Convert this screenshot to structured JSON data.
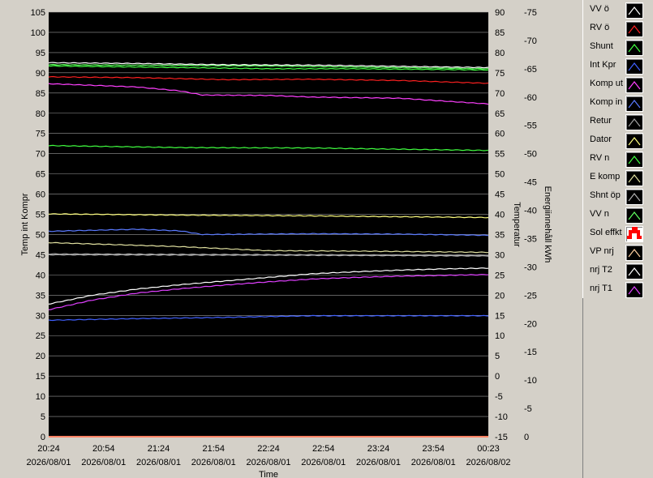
{
  "chart_data": {
    "type": "line",
    "xlabel": "Time",
    "x_ticks": [
      {
        "time": "20:24",
        "date": "2026/08/01"
      },
      {
        "time": "20:54",
        "date": "2026/08/01"
      },
      {
        "time": "21:24",
        "date": "2026/08/01"
      },
      {
        "time": "21:54",
        "date": "2026/08/01"
      },
      {
        "time": "22:24",
        "date": "2026/08/01"
      },
      {
        "time": "22:54",
        "date": "2026/08/01"
      },
      {
        "time": "23:24",
        "date": "2026/08/01"
      },
      {
        "time": "23:54",
        "date": "2026/08/01"
      },
      {
        "time": "00:23",
        "date": "2026/08/02"
      }
    ],
    "y_axes": {
      "left": {
        "label": "Temp int Kompr",
        "min": 0,
        "max": 105,
        "ticks": [
          0,
          5,
          10,
          15,
          20,
          25,
          30,
          35,
          40,
          45,
          50,
          55,
          60,
          65,
          70,
          75,
          80,
          85,
          90,
          95,
          100,
          105
        ]
      },
      "right1": {
        "label": "Temperatur",
        "min": -15,
        "max": 90,
        "ticks": [
          -15,
          -10,
          -5,
          0,
          5,
          10,
          15,
          20,
          25,
          30,
          35,
          40,
          45,
          50,
          55,
          60,
          65,
          70,
          75,
          80,
          85,
          90
        ]
      },
      "right2": {
        "label": "Energiinnehåll kWh",
        "min": 0,
        "max": -75,
        "ticks": [
          0,
          -5,
          -10,
          -15,
          -20,
          -25,
          -30,
          -35,
          -40,
          -45,
          -50,
          -55,
          -60,
          -65,
          -70,
          -75
        ]
      }
    },
    "grid": true,
    "legend_placement": "right",
    "background": "#000000",
    "series": [
      {
        "name": "VV ö",
        "color": "#ffffff",
        "axis": "right1",
        "points": [
          [
            0,
            77.5
          ],
          [
            0.2,
            77.3
          ],
          [
            0.4,
            77.0
          ],
          [
            0.6,
            76.9
          ],
          [
            0.8,
            76.6
          ],
          [
            1.0,
            76.3
          ]
        ]
      },
      {
        "name": "RV ö",
        "color": "#ff2020",
        "axis": "right1",
        "points": [
          [
            0,
            74.0
          ],
          [
            0.2,
            73.8
          ],
          [
            0.4,
            73.3
          ],
          [
            0.6,
            73.4
          ],
          [
            0.8,
            73.1
          ],
          [
            1.0,
            72.4
          ]
        ]
      },
      {
        "name": "Shunt",
        "color": "#40ff40",
        "axis": "right1",
        "points": [
          [
            0,
            76.7
          ],
          [
            0.3,
            76.3
          ],
          [
            0.5,
            76.0
          ],
          [
            0.7,
            76.0
          ],
          [
            1.0,
            75.7
          ]
        ]
      },
      {
        "name": "Int Kpr",
        "color": "#4060ff",
        "axis": "left",
        "points": [
          [
            0,
            28.8
          ],
          [
            0.2,
            29.2
          ],
          [
            0.4,
            29.5
          ],
          [
            0.6,
            29.9
          ],
          [
            1.0,
            29.9
          ]
        ]
      },
      {
        "name": "Komp ut",
        "color": "#ff40ff",
        "axis": "right1",
        "points": [
          [
            0,
            72.3
          ],
          [
            0.2,
            71.5
          ],
          [
            0.3,
            70.5
          ],
          [
            0.35,
            69.5
          ],
          [
            0.5,
            69.4
          ],
          [
            0.6,
            69.0
          ],
          [
            0.8,
            68.7
          ],
          [
            1.0,
            67.3
          ]
        ]
      },
      {
        "name": "Komp in",
        "color": "#5a7aff",
        "axis": "right1",
        "points": [
          [
            0,
            35.8
          ],
          [
            0.2,
            36.3
          ],
          [
            0.3,
            35.9
          ],
          [
            0.35,
            35.0
          ],
          [
            0.6,
            35.2
          ],
          [
            0.8,
            35.1
          ],
          [
            1.0,
            34.8
          ]
        ]
      },
      {
        "name": "Retur",
        "color": "#a0a0a0",
        "axis": "right1",
        "points": [
          [
            0,
            30.2
          ],
          [
            0.3,
            30.1
          ],
          [
            0.6,
            30.0
          ],
          [
            1.0,
            29.8
          ]
        ]
      },
      {
        "name": "Dator",
        "color": "#ffff80",
        "axis": "right1",
        "points": [
          [
            0,
            40.1
          ],
          [
            0.3,
            39.8
          ],
          [
            0.6,
            39.6
          ],
          [
            1.0,
            39.2
          ]
        ]
      },
      {
        "name": "RV n",
        "color": "#40ff40",
        "axis": "right1",
        "points": [
          [
            0,
            57.0
          ],
          [
            0.3,
            56.5
          ],
          [
            0.6,
            56.4
          ],
          [
            1.0,
            55.8
          ]
        ]
      },
      {
        "name": "E komp",
        "color": "#e0e0a0",
        "axis": "right1",
        "points": [
          [
            0,
            33.0
          ],
          [
            0.3,
            32.0
          ],
          [
            0.5,
            31.0
          ],
          [
            0.7,
            30.9
          ],
          [
            1.0,
            30.6
          ]
        ]
      },
      {
        "name": "Shnt öp",
        "color": "#b0b0b0",
        "axis": "right1",
        "points": [
          [
            0,
            30.0
          ],
          [
            0.5,
            29.9
          ],
          [
            1.0,
            29.7
          ]
        ]
      },
      {
        "name": "VV n",
        "color": "#60ff60",
        "axis": "right1",
        "points": [
          [
            0,
            77.0
          ],
          [
            0.5,
            76.7
          ],
          [
            1.0,
            76.0
          ]
        ]
      },
      {
        "name": "Sol effkt",
        "color": "#ff0000",
        "axis": "left",
        "points": [
          [
            0,
            0
          ],
          [
            1.0,
            0
          ]
        ]
      },
      {
        "name": "VP nrj",
        "color": "#ffd0a0",
        "axis": "right2",
        "points": [
          [
            0,
            0
          ],
          [
            1.0,
            0
          ]
        ]
      },
      {
        "name": "nrj T2",
        "color": "#ffffff",
        "axis": "left",
        "points": [
          [
            0,
            32.8
          ],
          [
            0.1,
            35.0
          ],
          [
            0.2,
            36.5
          ],
          [
            0.3,
            37.6
          ],
          [
            0.4,
            38.5
          ],
          [
            0.5,
            39.4
          ],
          [
            0.6,
            40.3
          ],
          [
            0.7,
            40.8
          ],
          [
            0.8,
            41.2
          ],
          [
            0.9,
            41.5
          ],
          [
            1.0,
            41.7
          ]
        ]
      },
      {
        "name": "nrj T1",
        "color": "#e040ff",
        "axis": "left",
        "points": [
          [
            0,
            31.4
          ],
          [
            0.1,
            33.8
          ],
          [
            0.2,
            35.5
          ],
          [
            0.3,
            36.6
          ],
          [
            0.4,
            37.5
          ],
          [
            0.5,
            38.3
          ],
          [
            0.6,
            39.0
          ],
          [
            0.7,
            39.4
          ],
          [
            0.8,
            39.7
          ],
          [
            0.9,
            39.9
          ],
          [
            1.0,
            40.1
          ]
        ]
      }
    ]
  }
}
